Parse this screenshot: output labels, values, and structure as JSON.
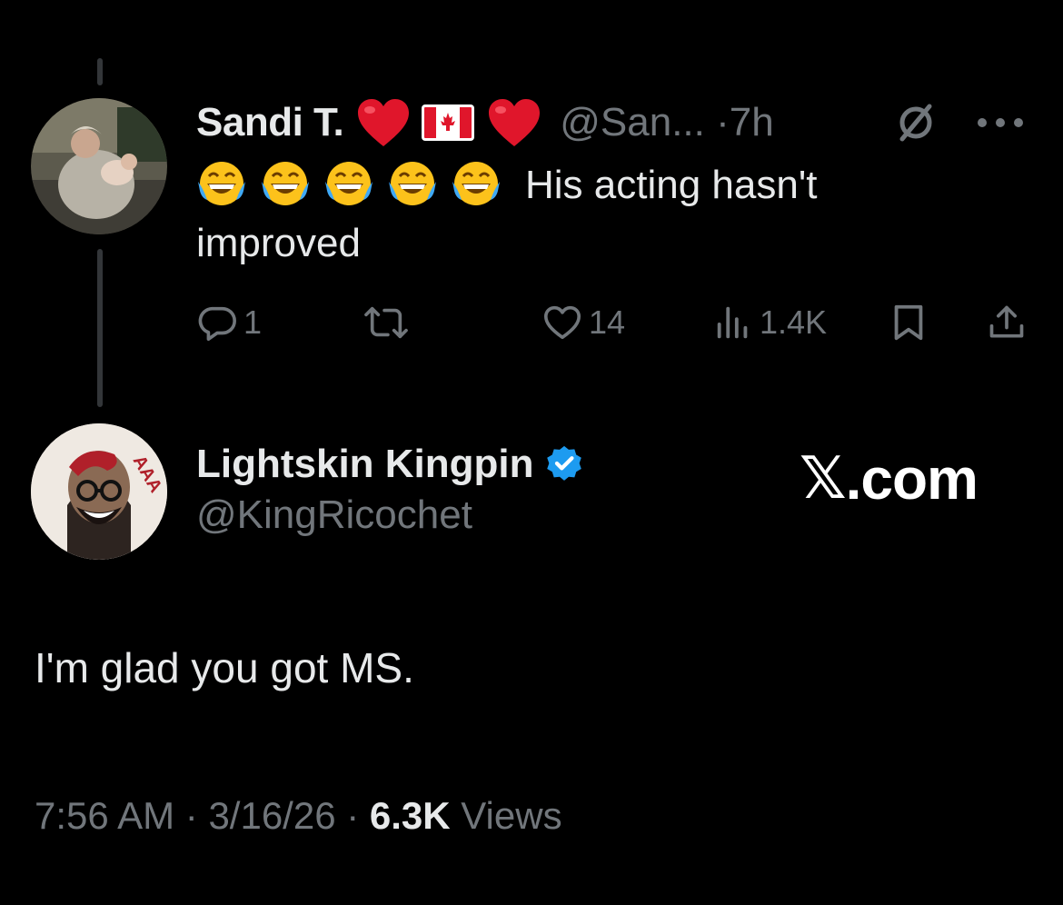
{
  "parent_tweet": {
    "author_name": "Sandi T.",
    "handle": "@San...",
    "separator": "·",
    "time": "7h",
    "text_after_emoji": "His acting hasn't",
    "text_line2": "improved",
    "emoji_count": 5,
    "actions": {
      "reply_count": "1",
      "retweet_count": "",
      "like_count": "14",
      "view_count": "1.4K"
    }
  },
  "main_tweet": {
    "author_name": "Lightskin Kingpin",
    "handle": "@KingRicochet",
    "text": "I'm glad you got MS.",
    "time": "7:56 AM",
    "sep1": " · ",
    "date": "3/16/26",
    "sep2": " · ",
    "views_count": "6.3K",
    "views_label": " Views"
  },
  "watermark": {
    "logo": "𝕏",
    "text": ".com"
  },
  "colors": {
    "background": "#000000",
    "text_primary": "#e7e9ea",
    "text_secondary": "#71767b",
    "verified_blue": "#1d9bf0",
    "heart_red": "#e0162b"
  },
  "icons": [
    "grok-icon",
    "more-icon",
    "reply-icon",
    "retweet-icon",
    "like-icon",
    "views-icon",
    "bookmark-icon",
    "share-icon",
    "verified-icon",
    "heart-emoji",
    "canada-flag-emoji",
    "laughing-emoji"
  ]
}
